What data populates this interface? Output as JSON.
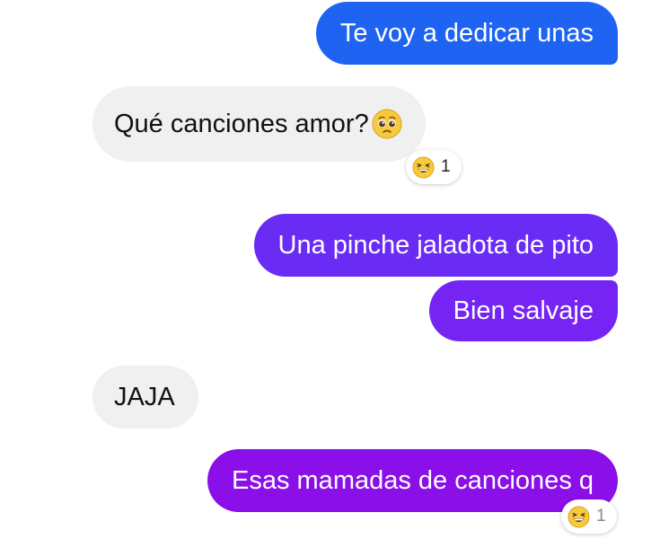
{
  "conversation": {
    "messages": [
      {
        "sender": "me",
        "text": "Te voy a dedicar unas"
      },
      {
        "sender": "them",
        "text": "Qué canciones amor?",
        "emoji": "pleading-face-icon",
        "reaction": {
          "emoji": "grinning-squinting-face-icon",
          "count": "1"
        }
      },
      {
        "sender": "me",
        "text": "Una pinche jaladota de pito"
      },
      {
        "sender": "me",
        "text": "Bien salvaje"
      },
      {
        "sender": "them",
        "text": "JAJA"
      },
      {
        "sender": "me",
        "text": "Esas mamadas de canciones q",
        "reaction": {
          "emoji": "grinning-squinting-face-icon",
          "count": "1"
        }
      }
    ]
  },
  "colors": {
    "sent_blue": "#1e63f2",
    "sent_purple": "#8a0fe8",
    "received_bg": "#f0f0f0"
  }
}
